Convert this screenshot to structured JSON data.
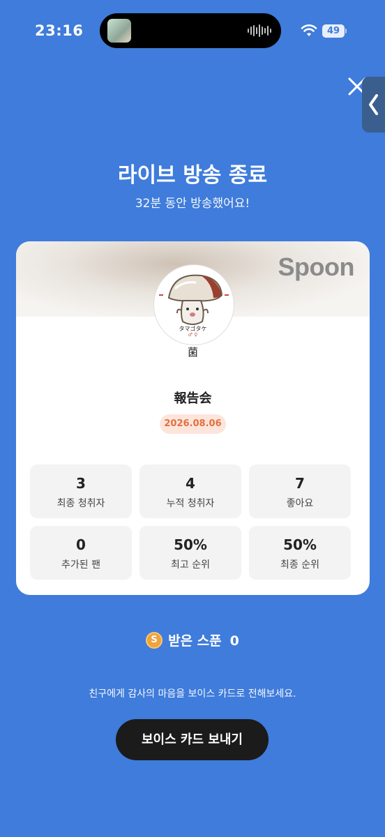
{
  "status_bar": {
    "time": "23:16",
    "battery": "49"
  },
  "header": {
    "title": "라이브 방송 종료",
    "subtitle": "32분 동안 방송했어요!"
  },
  "card": {
    "brand": "Spoon",
    "avatar_caption": "タマゴタケ",
    "nickname": "菌",
    "broadcast_title": "報告会",
    "date": "2026.08.06",
    "stats": [
      {
        "value": "3",
        "label": "최종 청취자"
      },
      {
        "value": "4",
        "label": "누적 청취자"
      },
      {
        "value": "7",
        "label": "좋아요"
      },
      {
        "value": "0",
        "label": "추가된 팬"
      },
      {
        "value": "50%",
        "label": "최고 순위"
      },
      {
        "value": "50%",
        "label": "최종 순위"
      }
    ]
  },
  "spoons": {
    "coin_letter": "S",
    "label": "받은 스푼",
    "count": "0"
  },
  "footer": {
    "message": "친구에게 감사의 마음을 보이스 카드로 전해보세요.",
    "button_label": "보이스 카드 보내기"
  },
  "colors": {
    "background": "#3f7cdb",
    "date_badge_text": "#e2703f",
    "button_bg": "#1b1b1b"
  }
}
